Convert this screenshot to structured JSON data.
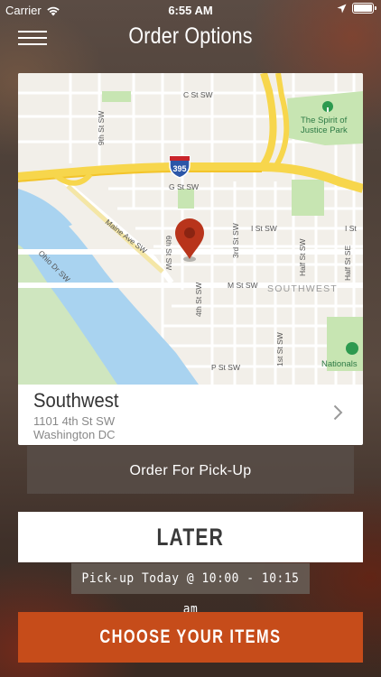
{
  "status_bar": {
    "carrier": "Carrier",
    "time": "6:55 AM",
    "icons": [
      "wifi-icon",
      "location-arrow-icon",
      "battery-icon"
    ],
    "battery_level": 1.0
  },
  "nav": {
    "title": "Order Options",
    "menu_icon": "hamburger-menu-icon"
  },
  "map": {
    "labels": {
      "c_st": "C St SW",
      "park": "The Spirit of",
      "park2": "Justice Park",
      "ninth": "9th St SW",
      "shield": "395",
      "g_st": "G St SW",
      "i_st": "I St SW",
      "maine": "Maine Ave SW",
      "sixth": "6th St SW",
      "third": "3rd St SW",
      "half": "Half St SW",
      "half_se": "Half St SE",
      "ohio": "Ohio Dr SW",
      "m_st": "M St SW",
      "southwest": "SOUTHWEST",
      "fourth": "4th St SW",
      "first": "1st St SW",
      "p_st": "P St SW",
      "nationals": "Nationals"
    },
    "colors": {
      "land": "#f2efe9",
      "water": "#a9d3f0",
      "park": "#c7e5b2",
      "highway": "#f7d64c",
      "pin": "#b8341b"
    }
  },
  "location": {
    "name": "Southwest",
    "address_line1": "1101 4th St SW",
    "address_line2": "Washington DC"
  },
  "buttons": {
    "pickup": "Order For Pick-Up",
    "later": "LATER",
    "choose": "CHOOSE YOUR ITEMS"
  },
  "pickup_time": "Pick-up Today @ 10:00 - 10:15 am",
  "colors": {
    "accent": "#c64c1a"
  }
}
